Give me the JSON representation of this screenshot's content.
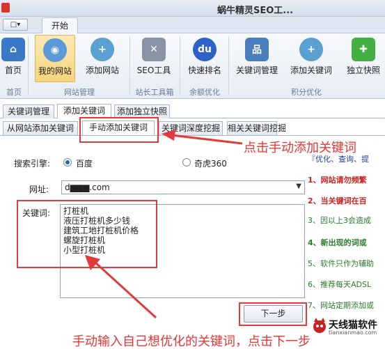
{
  "window": {
    "title": "蜗牛精灵SEO工..."
  },
  "quick_access": {
    "label": "□▾"
  },
  "ribbon_tab": {
    "label": "开始"
  },
  "ribbon": {
    "buttons": [
      {
        "label": "首页",
        "icon": "home-icon"
      },
      {
        "label": "我的网站",
        "icon": "globe-icon"
      },
      {
        "label": "添加网站",
        "icon": "add-site-icon"
      },
      {
        "label": "SEO工具",
        "icon": "tools-icon"
      },
      {
        "label": "快速排名",
        "icon": "baidu-icon"
      },
      {
        "label": "关键词管理",
        "icon": "network-icon"
      },
      {
        "label": "添加关键词",
        "icon": "add-keyword-icon"
      },
      {
        "label": "独立快照",
        "icon": "plus-icon"
      }
    ],
    "groups": [
      "首页",
      "网站管理",
      "站长工具箱",
      "余额优化",
      "积分优化"
    ]
  },
  "tabs_level1": [
    "关键词管理",
    "添加关键词",
    "添加独立快照"
  ],
  "tabs_level2": [
    "从网站添加关键词",
    "手动添加关键词",
    "关键词深度挖掘",
    "相关关键词挖掘"
  ],
  "form": {
    "engine_label": "搜索引擎:",
    "engine_options": [
      "百度",
      "奇虎360"
    ],
    "url_label": "网址:",
    "url_value": "d▆▆▆.com",
    "keywords_label": "关键词:",
    "keywords_text": "打桩机\n液压打桩机多少钱\n建筑工地打桩机价格\n螺旋打桩机\n小型打桩机",
    "next_label": "下一步"
  },
  "annotations": {
    "top": "点击手动添加关键词",
    "bottom": "手动输入自己想优化的关键词，点击下一步"
  },
  "tips": {
    "header": "『优化、查询、提",
    "items": [
      {
        "text": "1、网站请勿频繁",
        "color": "#cc2222"
      },
      {
        "text": "2、当关键词在百",
        "color": "#cc2222"
      },
      {
        "text": "3、因以上3会造成",
        "color": "#2a7d2a"
      },
      {
        "text": "4、新出现的词或",
        "color": "#2a7d2a"
      },
      {
        "text": "5、软件只作为辅助",
        "color": "#2a7d2a"
      },
      {
        "text": "6、推荐每天ADSL",
        "color": "#2a7d2a"
      },
      {
        "text": "7、网站定期添加或",
        "color": "#2a7d2a"
      }
    ]
  },
  "brand": {
    "name": "天线猫软件",
    "url": "tianxianmao.com"
  },
  "colors": {
    "accent_red": "#e23a3a",
    "tip_red": "#cc2222",
    "tip_green": "#2a7d2a"
  }
}
